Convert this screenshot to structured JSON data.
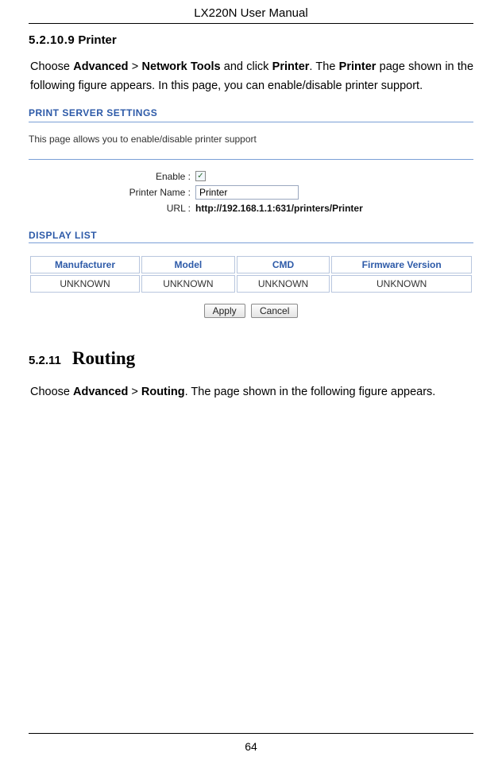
{
  "header": {
    "title": "LX220N User Manual"
  },
  "section1": {
    "number": "5.2.10.9",
    "title": "Printer",
    "para": {
      "t1": "Choose ",
      "b1": "Advanced",
      "t2": " > ",
      "b2": "Network Tools",
      "t3": " and click ",
      "b3": "Printer",
      "t4": ". The ",
      "b4": "Printer",
      "t5": " page shown in the following figure appears. In this page, you can enable/disable printer support."
    }
  },
  "panel": {
    "title": "PRINT SERVER SETTINGS",
    "desc": "This page allows you to enable/disable printer support",
    "form": {
      "enable_label": "Enable :",
      "enable_checked": true,
      "name_label": "Printer Name :",
      "name_value": "Printer",
      "url_label": "URL :",
      "url_value": "http://192.168.1.1:631/printers/Printer"
    },
    "display_title": "DISPLAY LIST",
    "table": {
      "headers": [
        "Manufacturer",
        "Model",
        "CMD",
        "Firmware Version"
      ],
      "row": [
        "UNKNOWN",
        "UNKNOWN",
        "UNKNOWN",
        "UNKNOWN"
      ]
    },
    "buttons": {
      "apply": "Apply",
      "cancel": "Cancel"
    }
  },
  "section2": {
    "number": "5.2.11",
    "title": "Routing",
    "para": {
      "t1": "Choose ",
      "b1": "Advanced",
      "t2": " > ",
      "b2": "Routing",
      "t3": ". The page shown in the following figure appears."
    }
  },
  "footer": {
    "page": "64"
  }
}
